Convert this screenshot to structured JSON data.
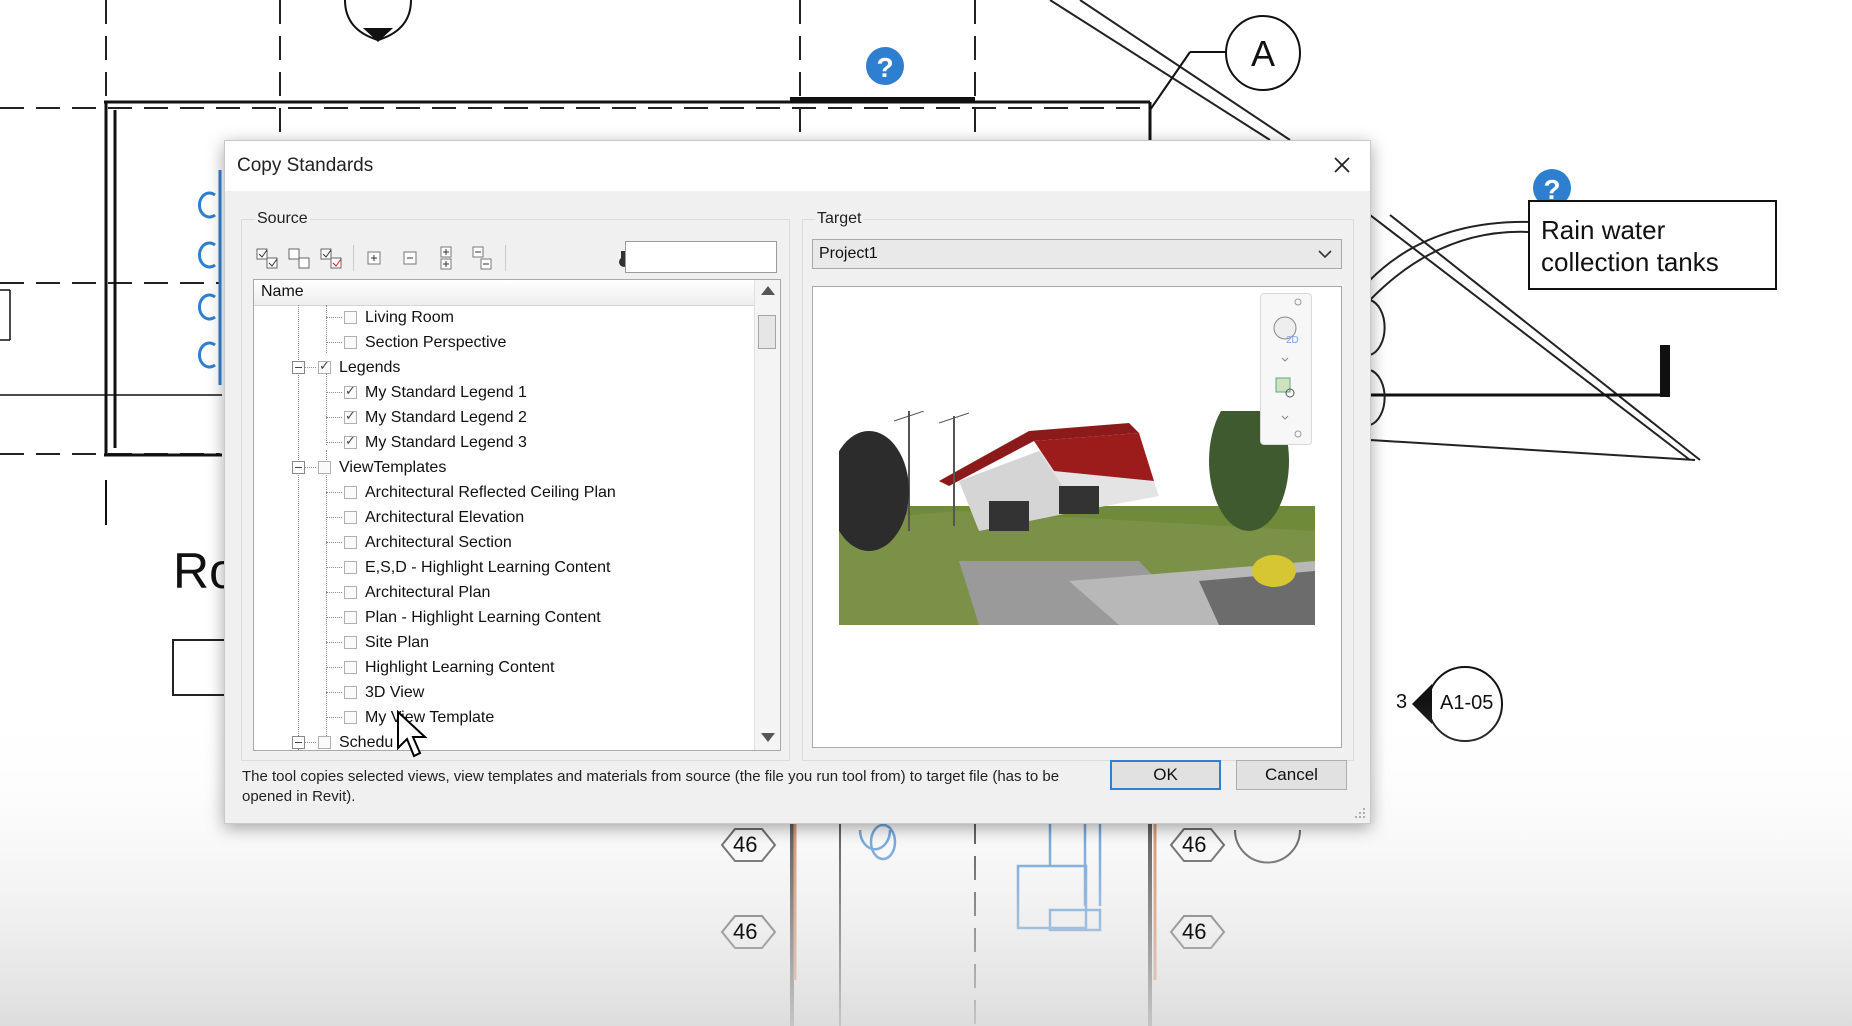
{
  "background": {
    "grid_bubble_label": "A",
    "room_label_partial": "Ro",
    "callout_text_line1": "Rain water",
    "callout_text_line2": "collection tanks",
    "section_number": "3",
    "section_sheet": "A1-05",
    "tag_value": "46",
    "help_icon": "question-icon",
    "colors": {
      "help_blue": "#2f7fd1",
      "line": "#111111",
      "accent_orange": "#d0662b"
    }
  },
  "dialog": {
    "title": "Copy Standards",
    "source": {
      "label": "Source",
      "search_value": "",
      "tree_header": "Name",
      "toolbar_icons": [
        "check-all-icon",
        "uncheck-all-icon",
        "check-selected-icon",
        "expand-icon",
        "collapse-icon",
        "expand-all-icon",
        "collapse-all-icon",
        "binoculars-icon"
      ],
      "tree_items": [
        {
          "label": "Living Room",
          "level": 2,
          "checked": false,
          "expander": false
        },
        {
          "label": "Section Perspective",
          "level": 2,
          "checked": false,
          "expander": false
        },
        {
          "label": "Legends",
          "level": 1,
          "checked": true,
          "expander": true
        },
        {
          "label": "My Standard Legend 1",
          "level": 2,
          "checked": true,
          "expander": false
        },
        {
          "label": "My Standard Legend 2",
          "level": 2,
          "checked": true,
          "expander": false
        },
        {
          "label": "My Standard Legend 3",
          "level": 2,
          "checked": true,
          "expander": false
        },
        {
          "label": "ViewTemplates",
          "level": 1,
          "checked": false,
          "expander": true
        },
        {
          "label": "Architectural Reflected Ceiling Plan",
          "level": 2,
          "checked": false,
          "expander": false
        },
        {
          "label": "Architectural Elevation",
          "level": 2,
          "checked": false,
          "expander": false
        },
        {
          "label": "Architectural Section",
          "level": 2,
          "checked": false,
          "expander": false
        },
        {
          "label": "E,S,D - Highlight Learning Content",
          "level": 2,
          "checked": false,
          "expander": false
        },
        {
          "label": "Architectural Plan",
          "level": 2,
          "checked": false,
          "expander": false
        },
        {
          "label": "Plan - Highlight Learning Content",
          "level": 2,
          "checked": false,
          "expander": false
        },
        {
          "label": "Site Plan",
          "level": 2,
          "checked": false,
          "expander": false
        },
        {
          "label": "Highlight Learning Content",
          "level": 2,
          "checked": false,
          "expander": false
        },
        {
          "label": "3D View",
          "level": 2,
          "checked": false,
          "expander": false
        },
        {
          "label": "My View Template",
          "level": 2,
          "checked": false,
          "expander": false
        },
        {
          "label": "Schedu",
          "level": 1,
          "checked": false,
          "expander": true
        }
      ]
    },
    "target": {
      "label": "Target",
      "project_value": "Project1",
      "view_cube_label": "2D"
    },
    "footer_note": "The tool copies selected views, view templates and materials from source (the file you run tool from) to target file (has to be opened in Revit).",
    "ok_label": "OK",
    "cancel_label": "Cancel"
  }
}
